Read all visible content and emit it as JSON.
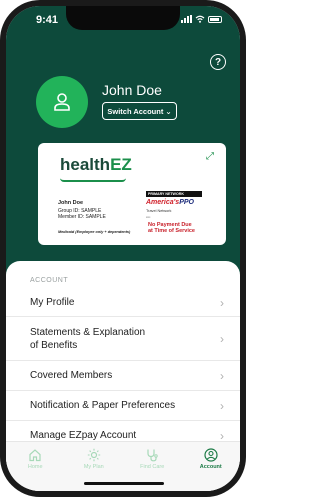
{
  "status_bar": {
    "time": "9:41"
  },
  "profile": {
    "name": "John Doe",
    "switch_account_label": "Switch Account",
    "help_label": "?"
  },
  "card": {
    "brand_prefix": "health",
    "brand_suffix": "EZ",
    "member_name": "John Doe",
    "group_id": "Group ID: SAMPLE",
    "member_id": "Member ID: SAMPLE",
    "medicaid_note": "Medicaid (Employee only + dependents)",
    "network_header": "PRIMARY NETWORK",
    "ppo_prefix": "America's",
    "ppo_suffix": "PPO",
    "travel_network": "Travel Network",
    "no_payment_line1": "No Payment Due",
    "no_payment_line2": "at Time of Service"
  },
  "account": {
    "section_label": "ACCOUNT",
    "items": [
      {
        "label": "My Profile"
      },
      {
        "label_line1": "Statements & Explanation",
        "label_line2": "of Benefits"
      },
      {
        "label": "Covered Members"
      },
      {
        "label": "Notification & Paper Preferences"
      },
      {
        "label": "Manage EZpay Account"
      }
    ]
  },
  "tabbar": {
    "tabs": [
      {
        "label": "Home",
        "icon": "home-icon",
        "active": false
      },
      {
        "label": "My Plan",
        "icon": "sun-icon",
        "active": false
      },
      {
        "label": "Find Care",
        "icon": "stethoscope-icon",
        "active": false
      },
      {
        "label": "Account",
        "icon": "account-icon",
        "active": true
      }
    ]
  },
  "colors": {
    "header_green": "#0d4a3b",
    "avatar_green": "#22b35a",
    "active_tab": "#1b7a45",
    "inactive_tab": "#a7d9b8"
  }
}
